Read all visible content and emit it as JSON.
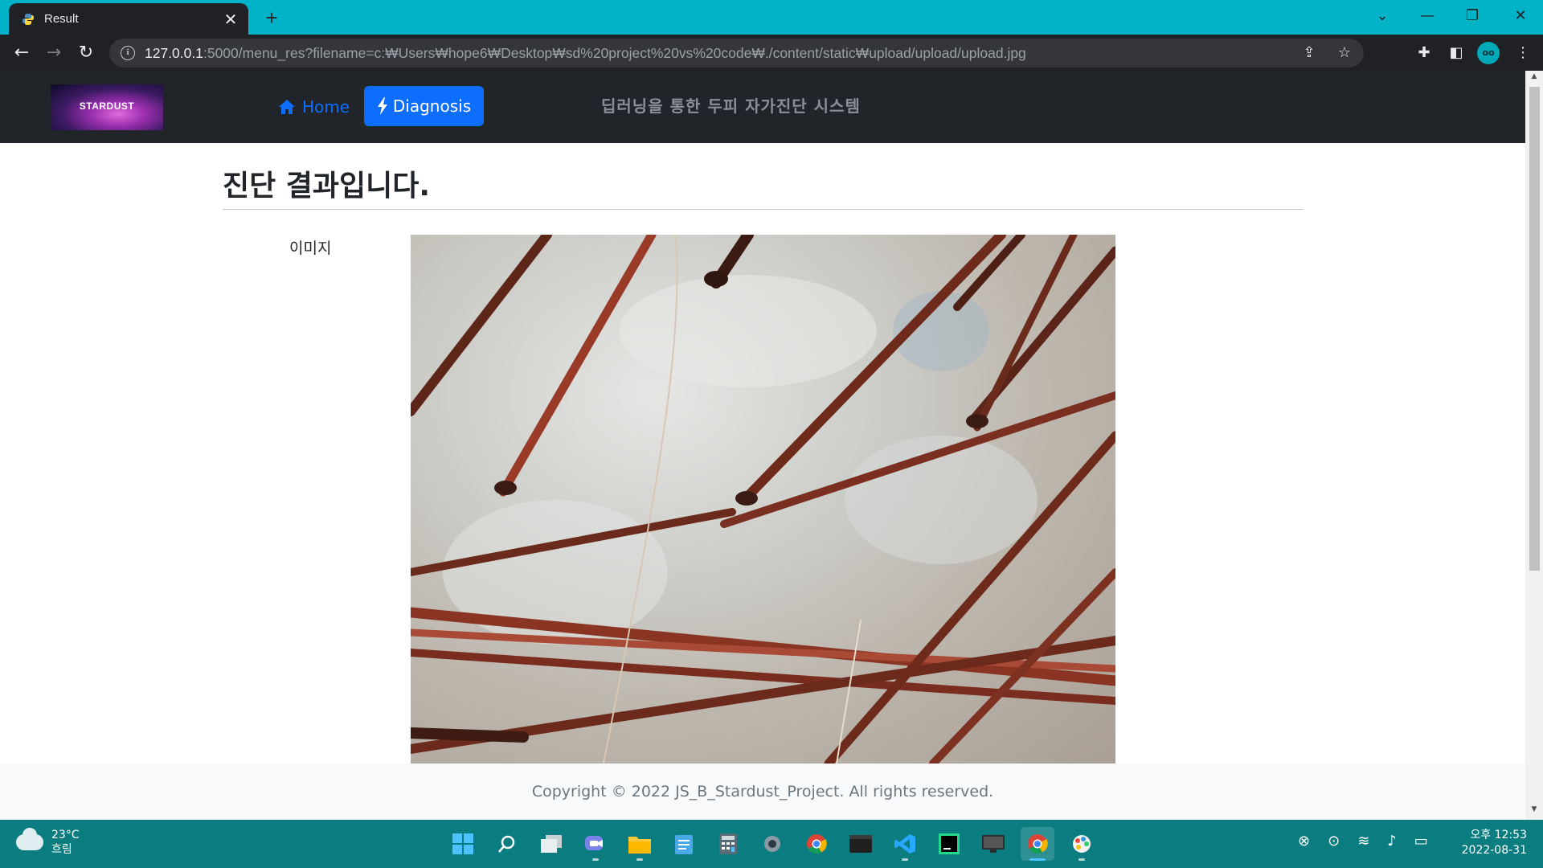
{
  "browser": {
    "tab_title": "Result",
    "tab_close": "✕",
    "new_tab": "+",
    "url_host": "127.0.0.1",
    "url_rest": ":5000/menu_res?filename=c:₩Users₩hope6₩Desktop₩sd%20project%20vs%20code₩./content/static₩upload/upload/upload.jpg",
    "profile_initials": "oo"
  },
  "site": {
    "logo_text": "STARDUST",
    "nav_home_label": "Home",
    "nav_diagnosis_label": "Diagnosis",
    "nav_title": "딥러닝을 통한 두피 자가진단 시스템",
    "brand_color": "#0d6efd",
    "nav_background": "#212529"
  },
  "main": {
    "heading": "진단 결과입니다.",
    "image_label": "이미지",
    "image_alt": "upload.jpg"
  },
  "footer": {
    "copyright": "Copyright © 2022 JS_B_Stardust_Project. All rights reserved."
  },
  "taskbar": {
    "weather_temp": "23°C",
    "weather_desc": "흐림",
    "time": "오후 12:53",
    "date": "2022-08-31",
    "apps": [
      "start",
      "search",
      "task-view",
      "teams-chat",
      "file-explorer",
      "notepad",
      "calculator",
      "settings",
      "chrome",
      "terminal",
      "vscode",
      "pycharm",
      "display",
      "chrome-active",
      "paint"
    ]
  }
}
